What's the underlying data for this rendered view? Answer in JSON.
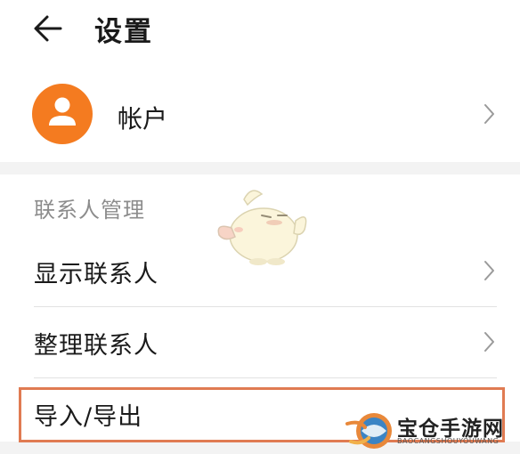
{
  "header": {
    "title": "设置",
    "back_icon": "arrow-left-icon"
  },
  "account": {
    "label": "帐户",
    "avatar_icon": "person-icon",
    "avatar_color": "#f47b20"
  },
  "contacts": {
    "section_title": "联系人管理",
    "items": [
      {
        "label": "显示联系人"
      },
      {
        "label": "整理联系人"
      },
      {
        "label": "导入/导出"
      }
    ]
  },
  "watermark": {
    "text": "宝仓手游网",
    "subtext": "BAOCANGSHOUYOUWANG"
  },
  "colors": {
    "highlight": "#e07b52",
    "accent": "#f47b20"
  }
}
